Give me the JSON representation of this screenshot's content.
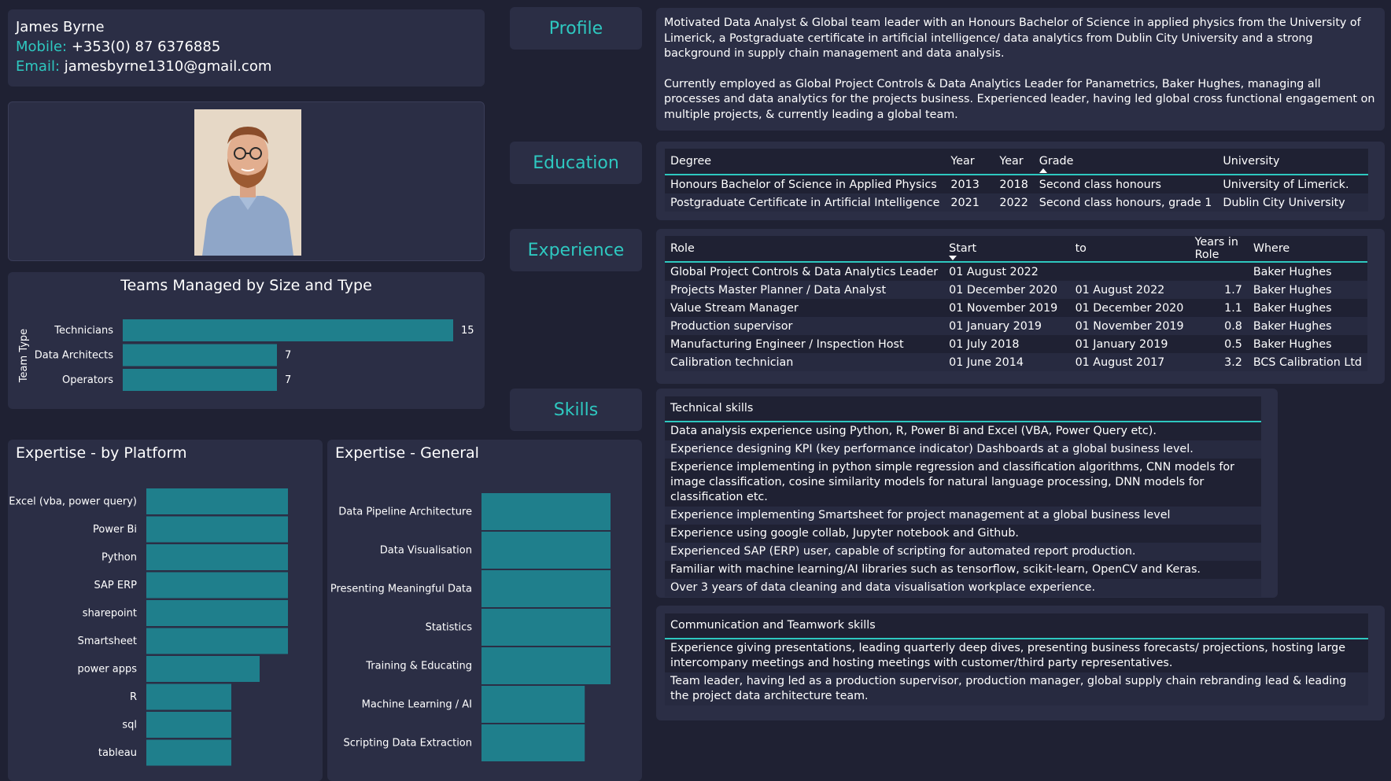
{
  "contact": {
    "name": "James Byrne",
    "mobile_label": "Mobile:",
    "mobile": "+353(0) 87 6376885",
    "email_label": "Email:",
    "email": "jamesbyrne1310@gmail.com"
  },
  "sections": {
    "profile": "Profile",
    "education": "Education",
    "experience": "Experience",
    "skills": "Skills"
  },
  "profile": {
    "para1": "Motivated Data Analyst & Global team leader with an Honours Bachelor of Science in applied physics from the University of Limerick, a Postgraduate certificate in artificial intelligence/ data analytics from Dublin City University and a strong background in supply chain management and data analysis.",
    "para2": "Currently employed as Global Project Controls & Data Analytics Leader for Panametrics, Baker Hughes, managing all processes and data analytics for the projects business. Experienced leader, having led global cross functional engagement on multiple projects, & currently leading a global team."
  },
  "education": {
    "headers": [
      "Degree",
      "Year",
      "Year",
      "Grade",
      "University"
    ],
    "rows": [
      [
        "Honours Bachelor of Science in Applied Physics",
        "2013",
        "2018",
        "Second class honours",
        "University of Limerick."
      ],
      [
        "Postgraduate Certificate in Artificial Intelligence",
        "2021",
        "2022",
        "Second class honours, grade 1",
        "Dublin City University"
      ]
    ]
  },
  "experience": {
    "headers": [
      "Role",
      "Start",
      "to",
      "Years in Role",
      "Where"
    ],
    "rows": [
      [
        "Global Project Controls & Data Analytics Leader",
        "01 August 2022",
        "",
        "",
        "Baker Hughes"
      ],
      [
        "Projects Master Planner / Data Analyst",
        "01 December 2020",
        "01 August 2022",
        "1.7",
        "Baker Hughes"
      ],
      [
        "Value Stream Manager",
        "01 November 2019",
        "01 December 2020",
        "1.1",
        "Baker Hughes"
      ],
      [
        "Production supervisor",
        "01 January 2019",
        "01 November 2019",
        "0.8",
        "Baker Hughes"
      ],
      [
        "Manufacturing Engineer / Inspection Host",
        "01 July 2018",
        "01 January 2019",
        "0.5",
        "Baker Hughes"
      ],
      [
        "Calibration technician",
        "01 June 2014",
        "01 August 2017",
        "3.2",
        "BCS Calibration Ltd"
      ]
    ]
  },
  "technical_skills": {
    "header": "Technical skills",
    "items": [
      "Data analysis experience using Python, R, Power Bi and Excel (VBA, Power Query etc).",
      "Experience designing KPI (key performance indicator) Dashboards at a global business level.",
      "Experience implementing in python simple regression and classification algorithms, CNN models for image classification, cosine similarity models for natural language processing, DNN models for classification etc.",
      "Experience implementing Smartsheet for project management at a global business level",
      "Experience using google collab, Jupyter notebook and Github.",
      "Experienced SAP (ERP) user, capable of scripting for automated report production.",
      "Familiar with machine learning/AI libraries such as tensorflow, scikit-learn, OpenCV and Keras.",
      "Over 3 years of data cleaning and data visualisation workplace experience."
    ]
  },
  "comm_skills": {
    "header": "Communication and Teamwork skills",
    "items": [
      "Experience giving presentations, leading quarterly deep dives, presenting business forecasts/ projections, hosting large intercompany meetings and hosting meetings with customer/third party representatives.",
      "Team leader, having led as a production supervisor, production manager, global supply chain rebranding lead & leading the project data architecture team."
    ]
  },
  "colors": {
    "accent": "#2ec8c0",
    "bar": "#1f7f8c",
    "background": "#1f2133",
    "panel": "#2b2e45"
  },
  "chart_data": [
    {
      "id": "teams",
      "type": "bar",
      "orientation": "horizontal",
      "title": "Teams Managed by Size and Type",
      "ylabel": "Team Type",
      "categories": [
        "Technicians",
        "Data Architects",
        "Operators"
      ],
      "values": [
        15,
        7,
        7
      ],
      "show_data_labels": true,
      "xlim": [
        0,
        15
      ]
    },
    {
      "id": "platform",
      "type": "bar",
      "orientation": "horizontal",
      "title": "Expertise - by Platform",
      "categories": [
        "Excel (vba, power query)",
        "Power Bi",
        "Python",
        "SAP ERP",
        "sharepoint",
        "Smartsheet",
        "power apps",
        "R",
        "sql",
        "tableau"
      ],
      "values": [
        5,
        5,
        5,
        5,
        5,
        5,
        4,
        3,
        3,
        3
      ],
      "xlim": [
        0,
        5
      ]
    },
    {
      "id": "general",
      "type": "bar",
      "orientation": "horizontal",
      "title": "Expertise - General",
      "categories": [
        "Data Pipeline Architecture",
        "Data Visualisation",
        "Presenting Meaningful Data",
        "Statistics",
        "Training & Educating",
        "Machine Learning / AI",
        "Scripting Data Extraction"
      ],
      "values": [
        5,
        5,
        5,
        5,
        5,
        4,
        4
      ],
      "xlim": [
        0,
        5
      ]
    }
  ]
}
